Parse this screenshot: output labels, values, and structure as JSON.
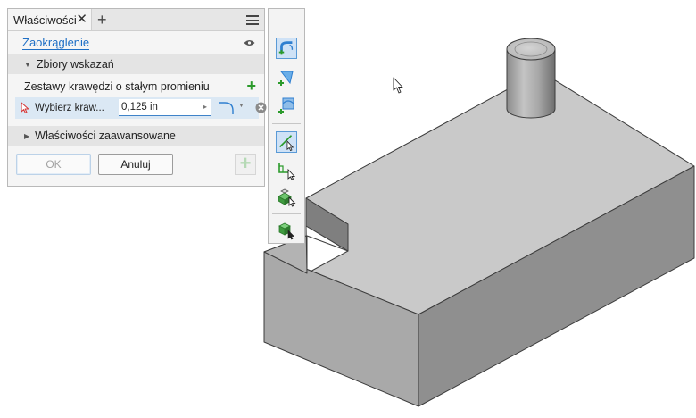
{
  "panel": {
    "tab_title": "Właściwości",
    "tab_close": "✕",
    "tab_add": "+",
    "feature_name": "Zaokrąglenie",
    "section_input_sets": "Zbiory wskazań",
    "edge_sets_label": "Zestawy krawędzi o stałym promieniu",
    "add_symbol": "+",
    "select_label": "Wybierz kraw...",
    "radius_value": "0,125 in",
    "section_advanced": "Właściwości zaawansowane",
    "ok_label": "OK",
    "cancel_label": "Anuluj",
    "apply_symbol": "+"
  },
  "toolbar": {
    "buttons": [
      "fillet-edge-icon",
      "fillet-face-icon",
      "full-round-fillet-icon",
      "edge-select-icon",
      "loop-select-icon",
      "feature-select-icon",
      "solid-select-icon"
    ],
    "active": "edge-select-icon"
  },
  "colors": {
    "accent_blue": "#1f6fc5",
    "add_green": "#2b9a2b",
    "selection_row": "#dbe8f4"
  }
}
